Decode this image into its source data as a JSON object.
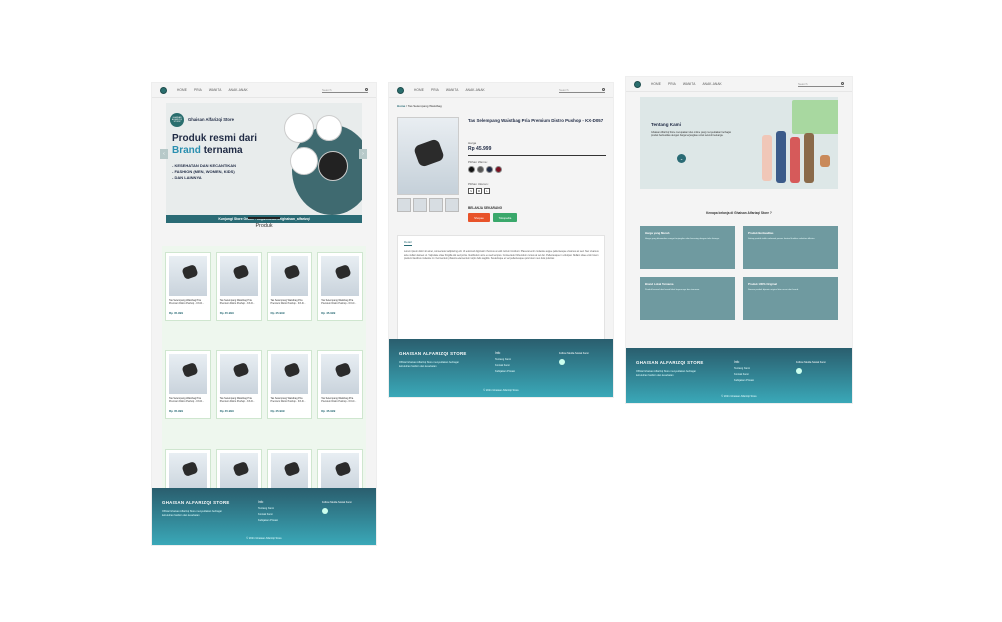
{
  "nav": {
    "items": [
      "HOME",
      "PRIA",
      "WANITA",
      "ANAK-ANAK"
    ],
    "search_placeholder": "Search"
  },
  "home": {
    "banner": {
      "badge": "GHAISAN ALFARIZQI STORE",
      "store": "Ghaisan Alfarizqi Store",
      "headline_1": "Produk resmi dari",
      "headline_2a": "Brand",
      "headline_2b": "ternama",
      "points": [
        "- KESEHATAN DAN KECANTIKAN",
        "- FASHION (MEN, WOMEN, KIDS)",
        "- DAN LAINNYA"
      ],
      "link_text": "Kunjungi Store Online : https://linktr.ee/ghaisan_alfarizqi"
    },
    "section_title": "Produk",
    "products": [
      {
        "name": "Tas Selempang Waistbag Pria Premium Distro Pushop - KX-D...",
        "price": "Rp 45.999"
      },
      {
        "name": "Tas Selempang Waistbag Pria Premium Distro Pushop - KX-D...",
        "price": "Rp 45.999"
      },
      {
        "name": "Tas Selempang Waistbag Pria Premium Distro Pushop - KX-D...",
        "price": "Rp 45.999"
      },
      {
        "name": "Tas Selempang Waistbag Pria Premium Distro Pushop - KX-D...",
        "price": "Rp 45.999"
      },
      {
        "name": "Tas Selempang Waistbag Pria Premium Distro Pushop - KX-D...",
        "price": "Rp 45.999"
      },
      {
        "name": "Tas Selempang Waistbag Pria Premium Distro Pushop - KX-D...",
        "price": "Rp 45.999"
      },
      {
        "name": "Tas Selempang Waistbag Pria Premium Distro Pushop - KX-D...",
        "price": "Rp 45.999"
      },
      {
        "name": "Tas Selempang Waistbag Pria Premium Distro Pushop - KX-D...",
        "price": "Rp 45.999"
      },
      {
        "name": "Tas Selempang Waistbag Pria Premium Distro Pushop - KX-D...",
        "price": "Rp 45.999"
      },
      {
        "name": "Tas Selempang Waistbag Pria Premium Distro Pushop - KX-D...",
        "price": "Rp 45.999"
      },
      {
        "name": "Tas Selempang Waistbag Pria Premium Distro Pushop - KX-D...",
        "price": "Rp 45.999"
      },
      {
        "name": "Tas Selempang Waistbag Pria Premium Distro Pushop - KX-D...",
        "price": "Rp 45.999"
      }
    ]
  },
  "footer": {
    "brand": "GHAISAN ALFARIZQI STORE",
    "desc": "Official Ghaisan Alfarizqi Store menyediakan berbagai kebutuhan fashion dan kesehatan",
    "info_title": "Info",
    "info_links": [
      "Tentang Kami",
      "Kontak Kami",
      "Kebijakan Privasi"
    ],
    "social_title": "Follow Media Sosial Kami",
    "copyright": "© 2021 Ghaisan Alfarizqi Store"
  },
  "detail": {
    "breadcrumb_home": "Home",
    "breadcrumb_rest": " / Tas Selempang Waistbag",
    "title": "Tas Selempang Waistbag Pria Premium Distro Pushop - KX-D057",
    "price_label": "Harga",
    "price": "Rp 45.999",
    "color_label": "Pilihan Warna :",
    "colors": [
      "#111111",
      "#555555",
      "#1f2a44",
      "#7a1020"
    ],
    "size_label": "Pilihan Ukuran :",
    "sizes": [
      "S",
      "M",
      "L"
    ],
    "buy_label": "BELANJA SEKARANG",
    "btn_shopee": "Shopee",
    "btn_tokopedia": "Tokopedia",
    "btn_shopee_color": "#e8532a",
    "btn_tokopedia_color": "#3aa86b",
    "desc_tab": "Detail",
    "desc_text": "Lorem ipsum dolor sit amet, consectetur adipiscing elit. Ut euismod dignissim rhoncus at velit rutrum tincidunt. Placerat enim molestie augue pellentesque vivamus ac sed. Nec vivamus ante nullam laoreet ut. Vulputate vitae fringilla dui sed porta. Vestibulum arcu eu sed tempus. Consectetur bibendum cursus at vel dui. Pellentesque in volutpat. Nullam vitae enim lorem pretium faucibus molestie mi. Fermentum pharetra elementum turpis felis sagittis. Scelerisque et vel pellentesque quis lorem nec duis pulvinar."
  },
  "about": {
    "title": "Tentang Kami",
    "text": "Ghaisan Alfarizqi Store merupakan toko online yang menyediakan berbagai produk berkualitas dengan harga terjangkau untuk seluruh keluarga.",
    "why_title": "Kenapa belanja di Ghaisan Alfarizqi Store ?",
    "reasons": [
      {
        "title": "Harga yang Murah",
        "text": "Harga yang ditawarkan sangat terjangkau dan bersaing dengan toko lainnya."
      },
      {
        "title": "Produk Berkualitas",
        "text": "Setiap produk telah melewati proses kontrol kualitas sebelum dikirim."
      },
      {
        "title": "Brand Lokal Ternama",
        "text": "Produk berasal dari brand lokal terpercaya dan ternama."
      },
      {
        "title": "Produk 100% Original",
        "text": "Semua produk dijamin original dan resmi dari brand."
      }
    ]
  }
}
